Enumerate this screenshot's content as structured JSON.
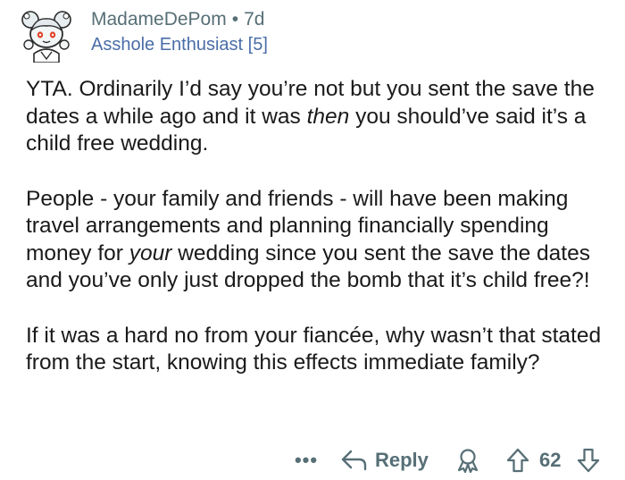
{
  "comment": {
    "username": "MadameDePom",
    "separator": "•",
    "time_ago": "7d",
    "flair": "Asshole Enthusiast [5]",
    "paragraphs": [
      {
        "before": "YTA. Ordinarily I’d say you’re not but you sent the save the dates a while ago and it was ",
        "emph": "then",
        "after": " you should’ve said it’s a child free wedding."
      },
      {
        "before": "People - your family and friends - will have been making travel arrangements and planning financially spending money for ",
        "emph": "your",
        "after": " wedding since you sent the save the dates and you’ve only just dropped the bomb that it’s child free?!"
      },
      {
        "before": "If it was a hard no from your fiancée, why wasn’t that stated from the start, knowing this effects immediate family?",
        "emph": "",
        "after": ""
      }
    ]
  },
  "actions": {
    "more_label": "•••",
    "reply_label": "Reply",
    "score": "62"
  },
  "icons": {
    "avatar": "snoo-avatar",
    "reply": "reply-arrow-icon",
    "award": "award-icon",
    "upvote": "upvote-arrow-icon",
    "downvote": "downvote-arrow-icon"
  },
  "colors": {
    "meta_text": "#576f76",
    "flair_text": "#4a6da8",
    "body_text": "#1a1a1b"
  }
}
